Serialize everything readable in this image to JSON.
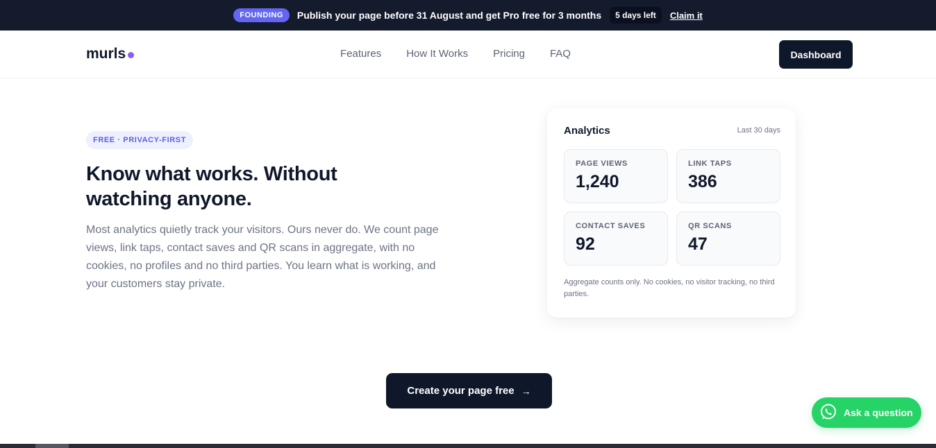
{
  "promo": {
    "badge": "FOUNDING",
    "message": "Publish your page before 31 August and get Pro free for 3 months",
    "countdown": "5 days left",
    "claim": "Claim it"
  },
  "nav": {
    "logo": "murls",
    "links": [
      "Features",
      "How It Works",
      "Pricing",
      "FAQ"
    ],
    "dashboard": "Dashboard"
  },
  "hero": {
    "pill": "FREE · PRIVACY-FIRST",
    "headline": "Know what works. Without watching anyone.",
    "body": "Most analytics quietly track your visitors. Ours never do. We count page views, link taps, contact saves and QR scans in aggregate, with no cookies, no profiles and no third parties. You learn what is working, and your customers stay private."
  },
  "analytics": {
    "title": "Analytics",
    "range": "Last 30 days",
    "stats": [
      {
        "label": "PAGE VIEWS",
        "value": "1,240"
      },
      {
        "label": "LINK TAPS",
        "value": "386"
      },
      {
        "label": "CONTACT SAVES",
        "value": "92"
      },
      {
        "label": "QR SCANS",
        "value": "47"
      }
    ],
    "note": "Aggregate counts only. No cookies, no visitor tracking, no third parties."
  },
  "cta": {
    "label": "Create your page free",
    "arrow": "→"
  },
  "whatsapp": {
    "label": "Ask a question",
    "icon": "whatsapp-icon"
  },
  "colors": {
    "promo_bg": "#141b2d",
    "badge": "#6366f1",
    "logo_dot": "#8b5cf6",
    "dark": "#0f172a",
    "whatsapp": "#25d366"
  }
}
